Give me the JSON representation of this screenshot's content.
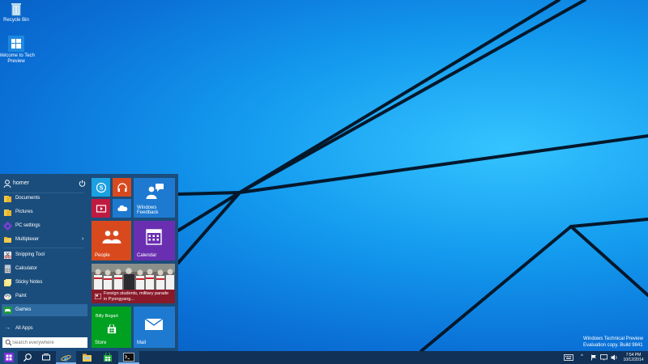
{
  "desktop": {
    "icons": [
      {
        "label": "Recycle Bin",
        "icon": "recycle-bin-icon"
      },
      {
        "label": "Welcome to Tech Preview",
        "icon": "windows-logo-icon"
      }
    ],
    "watermark": {
      "line1": "Windows Technical Preview",
      "line2": "Evaluation copy. Build 9841"
    }
  },
  "start_menu": {
    "user": {
      "name": "homer",
      "power_icon": "power-icon"
    },
    "items": [
      {
        "label": "Documents",
        "icon": "folder-icon"
      },
      {
        "label": "Pictures",
        "icon": "folder-icon"
      },
      {
        "label": "PC settings",
        "icon": "gear-icon"
      },
      {
        "label": "Multiplexer",
        "icon": "folder-icon",
        "arrow": "›"
      },
      {
        "label": "Snipping Tool",
        "icon": "scissors-icon"
      },
      {
        "label": "Calculator",
        "icon": "calculator-icon"
      },
      {
        "label": "Sticky Notes",
        "icon": "sticky-note-icon"
      },
      {
        "label": "Paint",
        "icon": "paint-icon"
      },
      {
        "label": "Games",
        "icon": "gamepad-icon"
      }
    ],
    "all_apps": {
      "label": "All Apps",
      "arrow": "→"
    },
    "search": {
      "placeholder": "Search everywhere"
    },
    "tiles": {
      "windows_feedback": "Windows Feedback",
      "people": "People",
      "calendar": "Calendar",
      "news_headline": "Foreign students, military parade in Pyongyang...",
      "store": "Store",
      "store_top": "Billy Bogart",
      "mail": "Mail"
    }
  },
  "taskbar": {
    "buttons": [
      "windows-start-icon",
      "search-icon",
      "task-view-icon",
      "internet-explorer-icon",
      "file-explorer-icon",
      "store-icon",
      "command-prompt-icon"
    ],
    "clock": {
      "time": "7:54 PM",
      "date": "10/12/2014"
    },
    "tray_chevron": "^"
  },
  "colors": {
    "start_menu_bg": "#1b4d7c",
    "taskbar_bg": "#113157",
    "tile_blue": "#1e7ad0",
    "tile_red": "#d84a1e",
    "tile_crimson": "#c01a40",
    "tile_purple": "#6a2fb0",
    "tile_green": "#00a020",
    "tile_skype": "#1ba0e2",
    "tile_mail": "#1e7ad0"
  }
}
